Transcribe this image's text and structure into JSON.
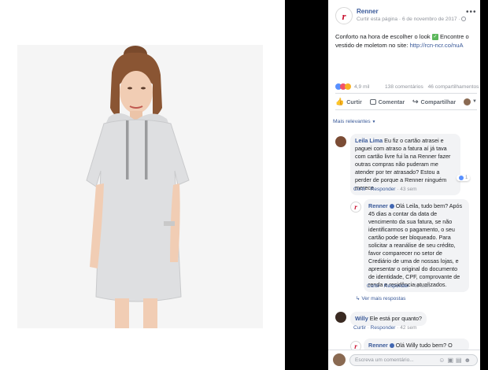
{
  "post": {
    "page_name": "Renner",
    "logo_letter": "r",
    "like_page": "Curtir esta página",
    "sep": "·",
    "date": "6 de novembro de 2017",
    "text_1": "Conforto na hora de escolher o look",
    "text_2": "Encontre o vestido de moletom no site:",
    "link": "http://rcn-ncr.co/nuA",
    "reactions_count": "4,9 mil",
    "comments_count": "138 comentários",
    "shares_count": "46 compartilhamentos",
    "like_label": "Curtir",
    "comment_label": "Comentar",
    "share_label": "Compartilhar",
    "more_icon": "more-options-icon",
    "globe_icon": "globe-icon"
  },
  "sort": {
    "label": "Mais relevantes"
  },
  "comments": [
    {
      "author": "Leila Lima",
      "text": "Eu fiz o cartão atrasei e paguei com atraso a fatura aí já tava com cartão livre fui la na Renner fazer outras compras não puderam me atender por ter atrasado? Estou a perder de porque a Renner ninguém merece",
      "like_label": "Curtir",
      "reply_label": "Responder",
      "time": "43 sem",
      "like_count": "1"
    },
    {
      "author": "Renner",
      "text": "Olá Leila, tudo bem? Após 45 dias a contar da data de vencimento da sua fatura, se não identificarmos o pagamento, o seu cartão pode ser bloqueado. Para solicitar a reanálise de seu crédito, favor comparecer no setor de Crediário de uma de nossas lojas, e apresentar o original do documento de identidade, CPF, comprovante de renda e residência atualizados.",
      "like_label": "Curtir",
      "reply_label": "Responder",
      "time": "43 sem"
    }
  ],
  "more_replies": "Ver mais respostas",
  "comment3": {
    "author": "Willy",
    "text": "Ele está por quanto?",
    "like_label": "Curtir",
    "reply_label": "Responder",
    "time": "42 sem"
  },
  "comment4": {
    "author": "Renner",
    "text": "Olá Willy tudo bem? O"
  },
  "composer": {
    "placeholder": "Escreva um comentário..."
  }
}
